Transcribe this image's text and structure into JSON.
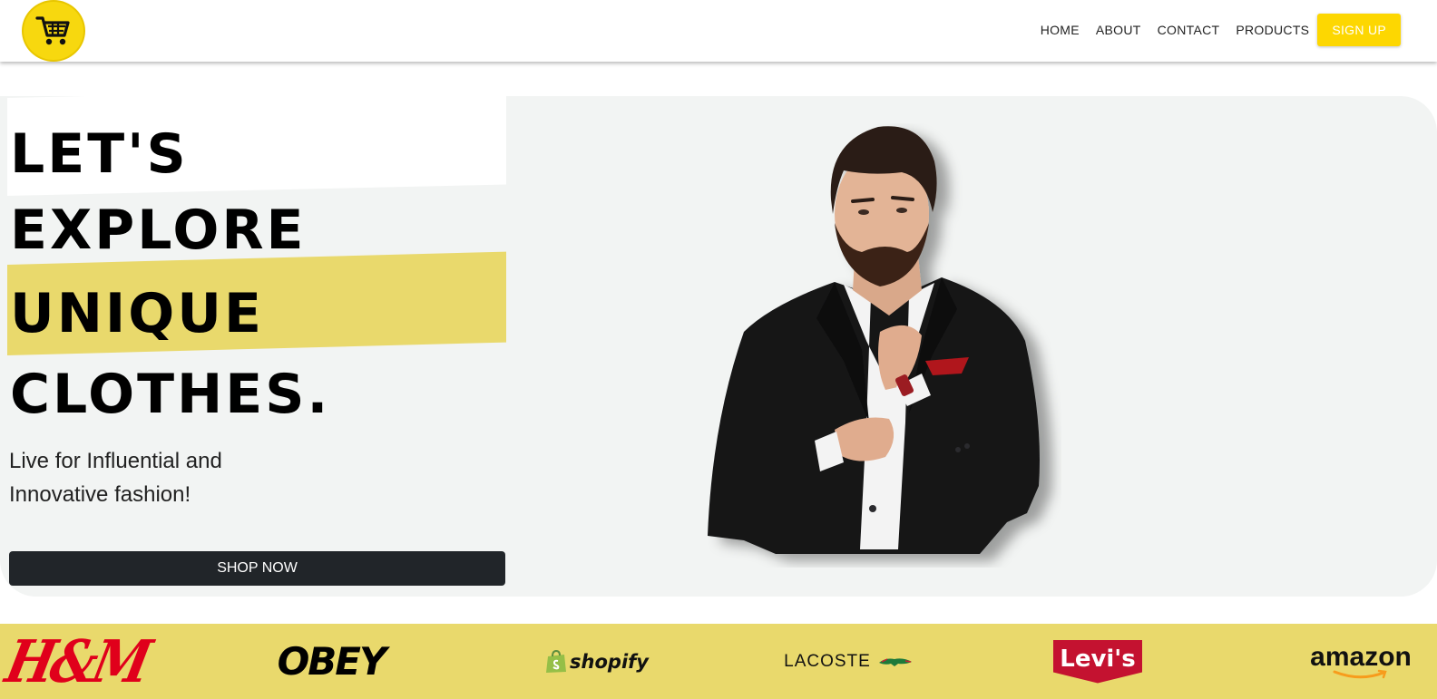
{
  "navbar": {
    "logo_icon": "shopping-cart-icon",
    "links": [
      "HOME",
      "ABOUT",
      "CONTACT",
      "PRODUCTS"
    ],
    "signup_label": "SIGN UP"
  },
  "hero": {
    "headline": [
      "LET'S",
      "EXPLORE",
      "UNIQUE",
      "CLOTHES."
    ],
    "tagline": "Live for Influential and Innovative fashion!",
    "cta_label": "SHOP NOW",
    "image": "man-in-black-suit-photo"
  },
  "brands": {
    "items": [
      "H&M",
      "OBEY",
      "shopify",
      "LACOSTE",
      "Levi's",
      "amazon"
    ]
  },
  "colors": {
    "accent_yellow": "#fdd701",
    "band_yellow": "#e9d96c",
    "hero_bg": "#f2f4f3",
    "cta_bg": "#212529"
  }
}
